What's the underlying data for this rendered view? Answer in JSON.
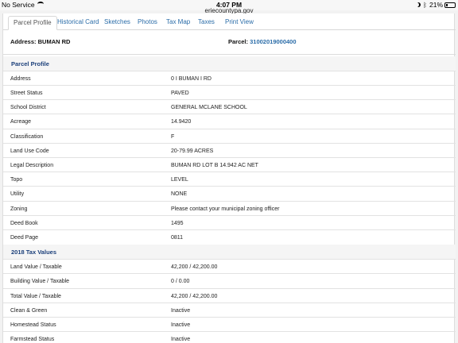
{
  "status_bar": {
    "carrier": "No Service",
    "time": "4:07 PM",
    "battery": "21%"
  },
  "url_bar": {
    "host": "eriecountypa.gov"
  },
  "tabs": [
    {
      "label": "Parcel Profile",
      "active": true
    },
    {
      "label": "Historical Card",
      "active": false
    },
    {
      "label": "Sketches",
      "active": false
    },
    {
      "label": "Photos",
      "active": false
    },
    {
      "label": "Tax Map",
      "active": false
    },
    {
      "label": "Taxes",
      "active": false
    },
    {
      "label": "Print View",
      "active": false
    }
  ],
  "header": {
    "address_label": "Address:",
    "address_value": "BUMAN RD",
    "parcel_label": "Parcel:",
    "parcel_value": "31002019000400"
  },
  "parcel_profile": {
    "title": "Parcel Profile",
    "rows": [
      {
        "label": "Address",
        "value": "0 I BUMAN I RD"
      },
      {
        "label": "Street Status",
        "value": "PAVED"
      },
      {
        "label": "School District",
        "value": "GENERAL MCLANE SCHOOL"
      },
      {
        "label": "Acreage",
        "value": "14.9420"
      },
      {
        "label": "Classification",
        "value": "F"
      },
      {
        "label": "Land Use Code",
        "value": "20-79.99 ACRES"
      },
      {
        "label": "Legal Description",
        "value": "BUMAN RD LOT B 14.942 AC NET"
      },
      {
        "label": "Topo",
        "value": "LEVEL"
      },
      {
        "label": "Utility",
        "value": "NONE"
      },
      {
        "label": "Zoning",
        "value": "Please contact your municipal zoning officer"
      },
      {
        "label": "Deed Book",
        "value": "1495"
      },
      {
        "label": "Deed Page",
        "value": "0811"
      }
    ]
  },
  "tax_values": {
    "title": "2018 Tax Values",
    "rows": [
      {
        "label": "Land Value / Taxable",
        "value": "42,200 / 42,200.00"
      },
      {
        "label": "Building Value / Taxable",
        "value": "0 / 0.00"
      },
      {
        "label": "Total Value / Taxable",
        "value": "42,200 / 42,200.00"
      },
      {
        "label": "Clean & Green",
        "value": "Inactive"
      },
      {
        "label": "Homestead Status",
        "value": "Inactive"
      },
      {
        "label": "Farmstead Status",
        "value": "Inactive"
      }
    ]
  }
}
